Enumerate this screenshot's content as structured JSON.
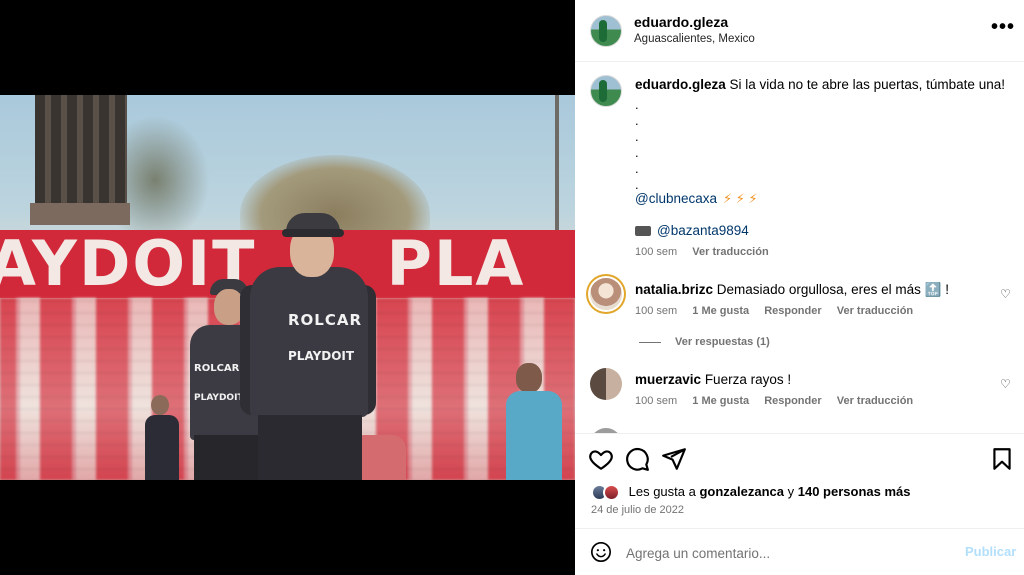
{
  "post": {
    "username": "eduardo.gleza",
    "location": "Aguascalientes, Mexico",
    "more_icon": "more-horizontal-icon"
  },
  "photo": {
    "banner_text_1": "AYDOIT",
    "banner_text_2": "PLA",
    "sponsor_1": "ROLCAR",
    "sponsor_2": "PLAYDOIT",
    "sponsor_3": "ROLCAR",
    "sponsor_4": "PLAYDOIT"
  },
  "caption": {
    "username": "eduardo.gleza",
    "text": "Si la vida no te abre las puertas, túmbate una!",
    "dots": ".\n.\n.\n.\n.\n.",
    "mention": "@clubnecaxa",
    "bolts": "⚡ ⚡ ⚡",
    "credit": "@bazanta9894",
    "time": "100 sem",
    "translate": "Ver traducción"
  },
  "comments": [
    {
      "username": "natalia.brizc",
      "text": "Demasiado orgullosa, eres el más 🔝 !",
      "time": "100 sem",
      "likes": "1 Me gusta",
      "reply": "Responder",
      "translate": "Ver traducción"
    },
    {
      "username": "muerzavic",
      "text": "Fuerza rayos !",
      "time": "100 sem",
      "likes": "1 Me gusta",
      "reply": "Responder",
      "translate": "Ver traducción"
    }
  ],
  "view_replies": "Ver respuestas (1)",
  "actions": {
    "like_icon": "heart-icon",
    "comment_icon": "comment-icon",
    "share_icon": "send-icon",
    "save_icon": "bookmark-icon"
  },
  "likes": {
    "prefix": "Les gusta a",
    "user": "gonzalezanca",
    "middle": "y",
    "count_text": "140 personas más"
  },
  "date": "24 de julio de 2022",
  "add_comment": {
    "placeholder": "Agrega un comentario...",
    "post_label": "Publicar",
    "emoji_icon": "smiley-icon"
  },
  "colors": {
    "link": "#00376b",
    "muted": "#737373",
    "post_disabled": "#b2dffc"
  }
}
